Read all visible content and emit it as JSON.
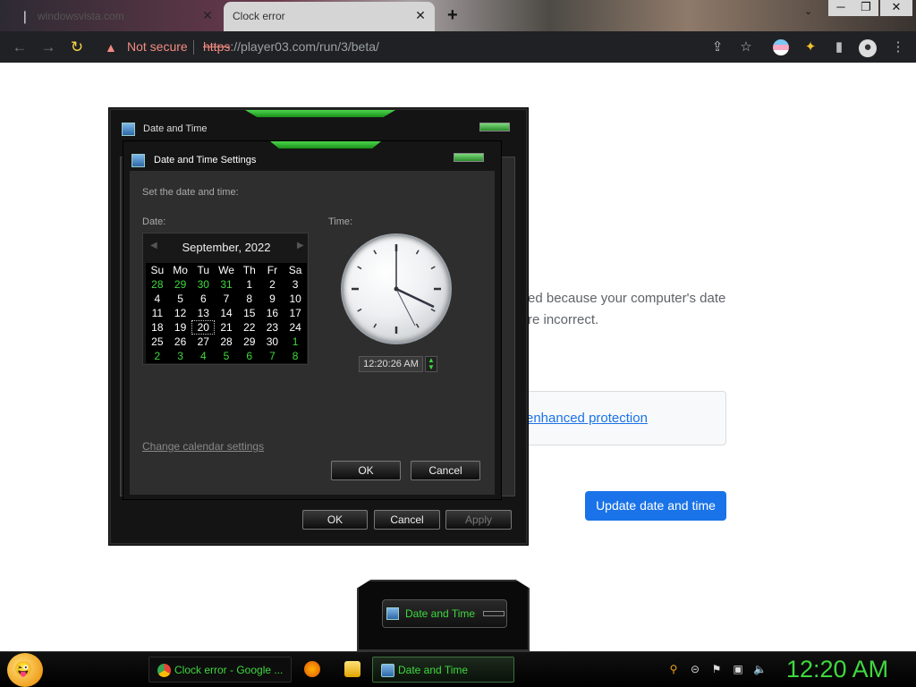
{
  "browser": {
    "tabs": [
      {
        "label": "windowsvista.com",
        "active": false
      },
      {
        "label": "Clock error",
        "active": true
      }
    ],
    "security_label": "Not secure",
    "url_scheme": "https",
    "url_rest": "://player03.com/run/3/beta/"
  },
  "page": {
    "error_line1": "ed because your computer's date",
    "error_line2": "re incorrect.",
    "protection_link": "enhanced protection",
    "update_button": "Update date and time"
  },
  "outer_window": {
    "title": "Date and Time",
    "buttons": {
      "ok": "OK",
      "cancel": "Cancel",
      "apply": "Apply"
    }
  },
  "settings_dialog": {
    "title": "Date and Time Settings",
    "instruction": "Set the date and time:",
    "date_label": "Date:",
    "time_label": "Time:",
    "calendar": {
      "month_year": "September, 2022",
      "weekdays": [
        "Su",
        "Mo",
        "Tu",
        "We",
        "Th",
        "Fr",
        "Sa"
      ],
      "weeks": [
        [
          "28",
          "29",
          "30",
          "31",
          "1",
          "2",
          "3"
        ],
        [
          "4",
          "5",
          "6",
          "7",
          "8",
          "9",
          "10"
        ],
        [
          "11",
          "12",
          "13",
          "14",
          "15",
          "16",
          "17"
        ],
        [
          "18",
          "19",
          "20",
          "21",
          "22",
          "23",
          "24"
        ],
        [
          "25",
          "26",
          "27",
          "28",
          "29",
          "30",
          "1"
        ],
        [
          "2",
          "3",
          "4",
          "5",
          "6",
          "7",
          "8"
        ]
      ],
      "selected_day": "20"
    },
    "time_value": "12:20:26 AM",
    "change_calendar_link": "Change calendar settings",
    "ok": "OK",
    "cancel": "Cancel"
  },
  "taskbar": {
    "preview_label": "Date and Time",
    "tasks": [
      {
        "label": "Clock error - Google ..."
      },
      {
        "label": "Date and Time"
      }
    ],
    "clock": "12:20 AM"
  },
  "colors": {
    "accent_green": "#3fd83f",
    "link_blue": "#1a73e8",
    "warning_red": "#f28b82"
  }
}
